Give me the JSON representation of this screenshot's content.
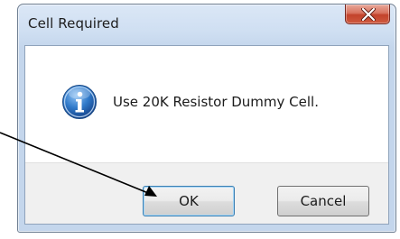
{
  "dialog": {
    "title": "Cell Required",
    "message": "Use 20K Resistor Dummy Cell.",
    "icon": "info-icon"
  },
  "buttons": {
    "ok_label": "OK",
    "cancel_label": "Cancel"
  },
  "titlebar": {
    "close_icon": "close-icon"
  },
  "annotation": {
    "arrow_icon": "arrow-icon",
    "target": "ok-button"
  }
}
